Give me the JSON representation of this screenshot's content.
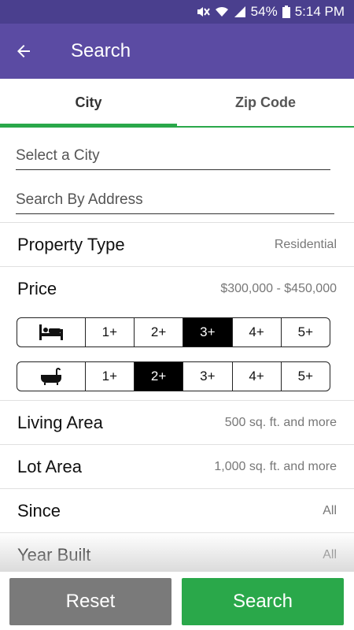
{
  "status": {
    "battery": "54%",
    "time": "5:14 PM"
  },
  "appbar": {
    "title": "Search"
  },
  "tabs": [
    {
      "label": "City"
    },
    {
      "label": "Zip Code"
    }
  ],
  "fields": {
    "city_placeholder": "Select a City",
    "address_placeholder": "Search By Address"
  },
  "rows": [
    {
      "label": "Property Type",
      "value": "Residential"
    },
    {
      "label": "Price",
      "value": "$300,000 - $450,000"
    },
    {
      "label": "Living Area",
      "value": "500 sq. ft. and more"
    },
    {
      "label": "Lot Area",
      "value": "1,000 sq. ft. and more"
    },
    {
      "label": "Since",
      "value": "All"
    },
    {
      "label": "Year Built",
      "value": "All"
    }
  ],
  "beds": {
    "options": [
      "1+",
      "2+",
      "3+",
      "4+",
      "5+"
    ],
    "selected": "3+"
  },
  "baths": {
    "options": [
      "1+",
      "2+",
      "3+",
      "4+",
      "5+"
    ],
    "selected": "2+"
  },
  "buttons": {
    "reset": "Reset",
    "search": "Search"
  },
  "colors": {
    "appbar": "#5b4ba3",
    "accent": "#2aa84a",
    "reset": "#7a7a7a"
  }
}
